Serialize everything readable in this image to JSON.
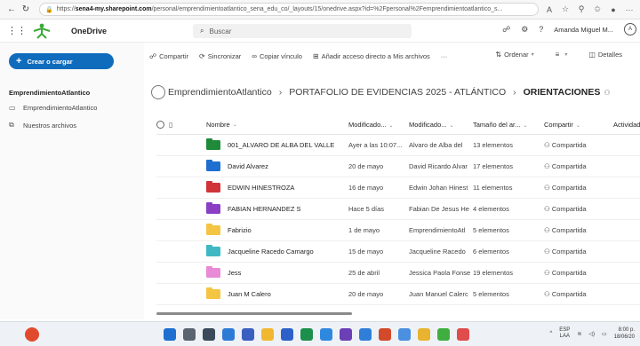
{
  "browser": {
    "url_prefix": "https://",
    "url_host": "sena4-my.sharepoint.com",
    "url_path": "/personal/emprendimientoatlantico_sena_edu_co/_layouts/15/onedrive.aspx?id=%2Fpersonal%2Femprendimientoatlantico_s..."
  },
  "header": {
    "app_name": "OneDrive",
    "search_placeholder": "Buscar",
    "user_name": "Amanda Miguel M...",
    "avatar_initial": "A"
  },
  "sidebar": {
    "create_label": "Crear o cargar",
    "section_title": "EmprendimientoAtlantico",
    "items": [
      {
        "label": "EmprendimientoAtlantico"
      },
      {
        "label": "Nuestros archivos"
      }
    ]
  },
  "command_bar": {
    "share": "Compartir",
    "sync": "Sincronizar",
    "copy_link": "Copiar vínculo",
    "add_shortcut": "Añadir acceso directo a Mis archivos",
    "more": "···",
    "sort": "Ordenar",
    "details": "Detalles"
  },
  "breadcrumb": {
    "root": "EmprendimientoAtlantico",
    "parent": "PORTAFOLIO DE EVIDENCIAS 2025 - ATLÁNTICO",
    "current": "ORIENTACIONES"
  },
  "table": {
    "headers": {
      "name": "Nombre",
      "modified": "Modificado...",
      "modified_by": "Modificado...",
      "size": "Tamaño del ar...",
      "share": "Compartir",
      "activity": "Actividad"
    },
    "rows": [
      {
        "name": "001_ALVARO DE ALBA DEL VALLE",
        "modified": "Ayer a las 10:07...",
        "modified_by": "Alvaro de Alba del",
        "size": "13 elementos",
        "share": "Compartida",
        "color": "#1f8a3a"
      },
      {
        "name": "David Alvarez",
        "modified": "20 de mayo",
        "modified_by": "David Ricardo Alvar",
        "size": "17 elementos",
        "share": "Compartida",
        "color": "#1f6fd1"
      },
      {
        "name": "EDWIN HINESTROZA",
        "modified": "16 de mayo",
        "modified_by": "Edwin Johan Hinest",
        "size": "11 elementos",
        "share": "Compartida",
        "color": "#d13438"
      },
      {
        "name": "FABIAN HERNANDEZ S",
        "modified": "Hace 5 días",
        "modified_by": "Fabian De Jesus He",
        "size": "4 elementos",
        "share": "Compartida",
        "color": "#8a3fc4"
      },
      {
        "name": "Fabrizio",
        "modified": "1 de mayo",
        "modified_by": "EmprendimientoAtl",
        "size": "5 elementos",
        "share": "Compartida",
        "color": "#f4c542"
      },
      {
        "name": "Jacqueline Racedo Camargo",
        "modified": "15 de mayo",
        "modified_by": "Jacqueline Racedo",
        "size": "6 elementos",
        "share": "Compartida",
        "color": "#3fb8c4"
      },
      {
        "name": "Jess",
        "modified": "25 de abril",
        "modified_by": "Jessica Paola Fonse",
        "size": "19 elementos",
        "share": "Compartida",
        "color": "#e88ad6"
      },
      {
        "name": "Juan M Calero",
        "modified": "20 de mayo",
        "modified_by": "Juan Manuel Calerc",
        "size": "5 elementos",
        "share": "Compartida",
        "color": "#f4c542"
      }
    ]
  },
  "taskbar": {
    "lang_top": "ESP",
    "lang_bottom": "LAA",
    "time": "8:00 p.",
    "date": "18/06/20"
  }
}
